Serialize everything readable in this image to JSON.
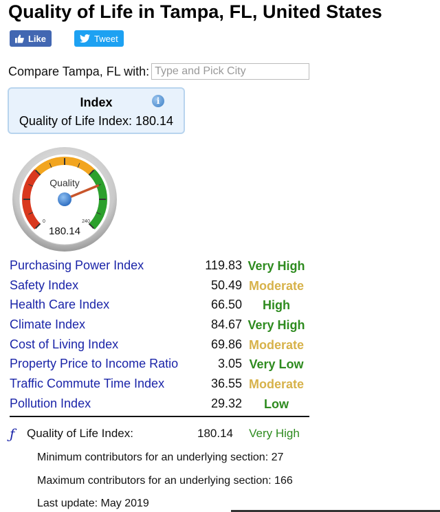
{
  "page": {
    "title": "Quality of Life in Tampa, FL, United States"
  },
  "social": {
    "like_label": "Like",
    "tweet_label": "Tweet",
    "like_color": "#4267b2",
    "tweet_color": "#1da1f2"
  },
  "compare": {
    "label": "Compare Tampa, FL with:",
    "placeholder": "Type and Pick City",
    "value": ""
  },
  "index_box": {
    "heading": "Index",
    "line": "Quality of Life Index: 180.14",
    "icon": "info-icon"
  },
  "gauge": {
    "label": "Quality",
    "value_text": "180.14",
    "value": 180.14,
    "min_label": "0",
    "max_label": "240",
    "min": 0,
    "max": 240,
    "colors": {
      "low": "#d9381e",
      "mid": "#f2a51f",
      "high": "#2ca02c",
      "needle": "#c8552b",
      "hub": "#4a88d8"
    }
  },
  "metrics": [
    {
      "name": "Purchasing Power Index",
      "value": "119.83",
      "level": "Very High",
      "level_color": "#2e8b1f"
    },
    {
      "name": "Safety Index",
      "value": "50.49",
      "level": "Moderate",
      "level_color": "#d7b24a"
    },
    {
      "name": "Health Care Index",
      "value": "66.50",
      "level": "High",
      "level_color": "#2e8b1f"
    },
    {
      "name": "Climate Index",
      "value": "84.67",
      "level": "Very High",
      "level_color": "#2e8b1f"
    },
    {
      "name": "Cost of Living Index",
      "value": "69.86",
      "level": "Moderate",
      "level_color": "#d7b24a"
    },
    {
      "name": "Property Price to Income Ratio",
      "value": "3.05",
      "level": "Very Low",
      "level_color": "#2e8b1f"
    },
    {
      "name": "Traffic Commute Time Index",
      "value": "36.55",
      "level": "Moderate",
      "level_color": "#d7b24a"
    },
    {
      "name": "Pollution Index",
      "value": "29.32",
      "level": "Low",
      "level_color": "#2e8b1f"
    }
  ],
  "summary": {
    "icon": "ƒ",
    "label": "Quality of Life Index:",
    "value": "180.14",
    "level": "Very High"
  },
  "notes": {
    "min_contributors": "Minimum contributors for an underlying section: 27",
    "max_contributors": "Maximum contributors for an underlying section: 166",
    "last_update": "Last update: May 2019"
  },
  "colors": {
    "link": "#1a24a8",
    "good": "#2e8b1f",
    "moderate": "#d7b24a"
  }
}
